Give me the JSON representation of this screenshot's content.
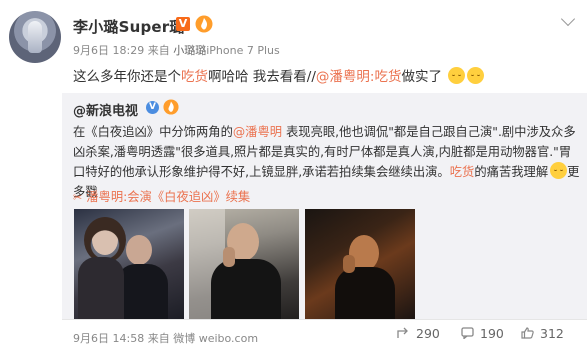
{
  "author": {
    "name": "李小璐Super璐",
    "vip_badge": "V",
    "level_icon": "level-flame-icon"
  },
  "post": {
    "time": "9月6日 18:29",
    "source_prefix": "来自",
    "source": "小璐璐",
    "device": "iPhone 7 Plus",
    "text_1": "这么多年你还是个",
    "keyword": "吃货",
    "text_2": "啊哈哈 我去看看//",
    "mention": "@潘粤明",
    "text_3": ":吃货",
    "text_4": "做实了",
    "emoji_icon": "sad-face-icon"
  },
  "repost": {
    "author": "@新浪电视",
    "text_a": "在《白夜追凶》中分饰两角的",
    "mention": "@潘粤明",
    "text_b": " 表现亮眼,他也调侃\"都是自己跟自己演\".剧中涉及众多凶杀案,潘粤明透露\"很多道具,照片都是真实的,有时尸体都是真人演,内脏都是用动物器官.\"胃口特好的他承认形象维护得不好,上镜显胖,承诺若拍续集会继续出演。",
    "keyword": "吃货",
    "text_c": "的痛苦我理解",
    "text_d": "更多戳",
    "link_text": "潘粤明:会演《白夜追凶》续集",
    "time": "9月6日 14:58",
    "source_prefix": "来自",
    "source": "微博 weibo.com",
    "repost_count": "290",
    "comment_count": "190",
    "like_count": "312"
  },
  "colors": {
    "accent": "#eb7350",
    "repost_bg": "#f2f2f5",
    "vip": "#f86a19",
    "verified": "#4b8de0"
  }
}
